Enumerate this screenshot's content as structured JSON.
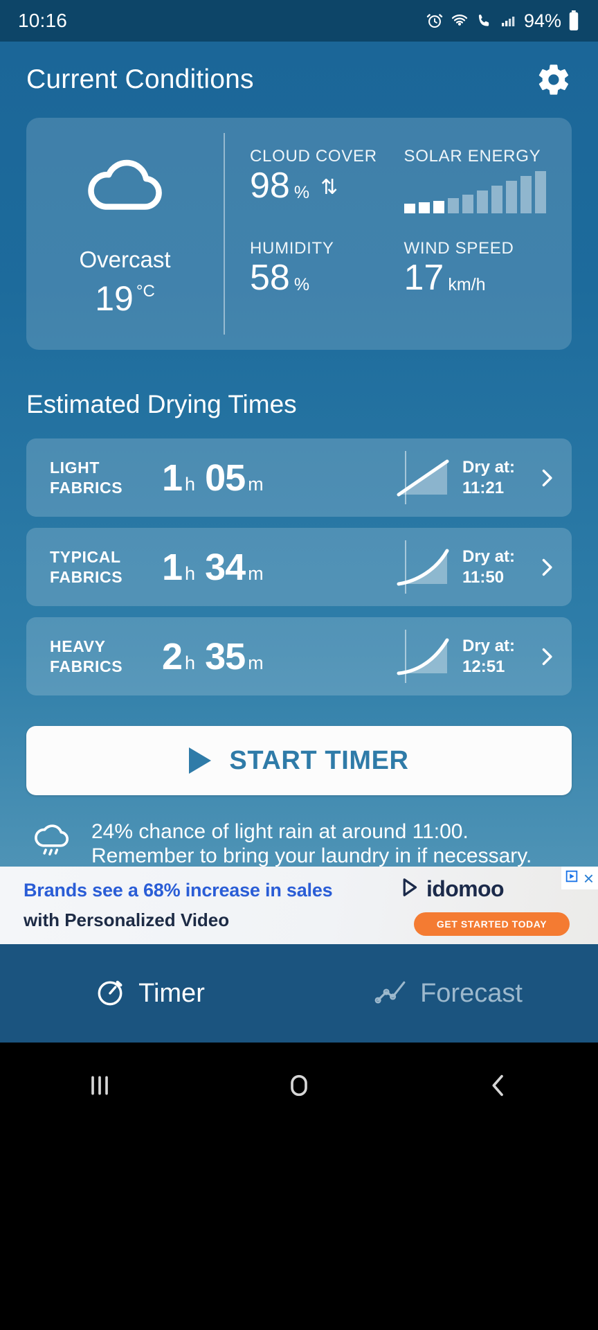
{
  "status_bar": {
    "time": "10:16",
    "battery_pct": "94%",
    "icons": [
      "alarm-icon",
      "wifi-icon",
      "call-icon",
      "signal-icon",
      "battery-icon"
    ]
  },
  "header": {
    "title": "Current Conditions",
    "settings_icon": "gear-icon"
  },
  "current_conditions": {
    "icon": "cloud-icon",
    "condition": "Overcast",
    "temperature": "19",
    "temperature_unit": "°C",
    "metrics": [
      {
        "label": "CLOUD COVER",
        "value": "98",
        "unit": "%",
        "trend_icon": "up-down-arrows-icon"
      },
      {
        "label": "SOLAR ENERGY",
        "value": "",
        "unit": "",
        "chart_icon": "solar-bars-icon"
      },
      {
        "label": "HUMIDITY",
        "value": "58",
        "unit": "%"
      },
      {
        "label": "WIND SPEED",
        "value": "17",
        "unit": "km/h"
      }
    ]
  },
  "drying": {
    "section_title": "Estimated Drying Times",
    "rows": [
      {
        "fabric_line1": "LIGHT",
        "fabric_line2": "FABRICS",
        "hours": "1",
        "h_unit": "h",
        "minutes": "05",
        "m_unit": "m",
        "dry_label": "Dry at:",
        "dry_time": "11:21",
        "spark_icon": "drying-curve-icon",
        "chevron": "chevron-right-icon"
      },
      {
        "fabric_line1": "TYPICAL",
        "fabric_line2": "FABRICS",
        "hours": "1",
        "h_unit": "h",
        "minutes": "34",
        "m_unit": "m",
        "dry_label": "Dry at:",
        "dry_time": "11:50",
        "spark_icon": "drying-curve-icon",
        "chevron": "chevron-right-icon"
      },
      {
        "fabric_line1": "HEAVY",
        "fabric_line2": "FABRICS",
        "hours": "2",
        "h_unit": "h",
        "minutes": "35",
        "m_unit": "m",
        "dry_label": "Dry at:",
        "dry_time": "12:51",
        "spark_icon": "drying-curve-icon",
        "chevron": "chevron-right-icon"
      }
    ]
  },
  "start_timer": {
    "label": "START TIMER",
    "icon": "play-icon"
  },
  "rain_note": {
    "icon": "cloud-rain-icon",
    "text": "24% chance of light rain at around 11:00. Remember to bring your laundry in if necessary."
  },
  "ad": {
    "line1": "Brands see a 68% increase in sales",
    "line2": "with Personalized Video",
    "brand": "idomoo",
    "cta": "GET STARTED TODAY",
    "close_label": "×",
    "adchoices_icon": "adchoices-icon"
  },
  "bottom_tabs": [
    {
      "label": "Timer",
      "icon": "stopwatch-icon",
      "active": true
    },
    {
      "label": "Forecast",
      "icon": "line-chart-icon",
      "active": false
    }
  ],
  "android_nav": {
    "recents": "recents-icon",
    "home": "home-icon",
    "back": "back-icon"
  },
  "colors": {
    "app_top": "#1b6698",
    "app_bottom": "#7fb0c6",
    "status_bar": "#0d4568",
    "tabbar": "#1b547f",
    "accent": "#2f7ba8",
    "ad_headline": "#2a5dd6",
    "cta": "#f47b32"
  }
}
